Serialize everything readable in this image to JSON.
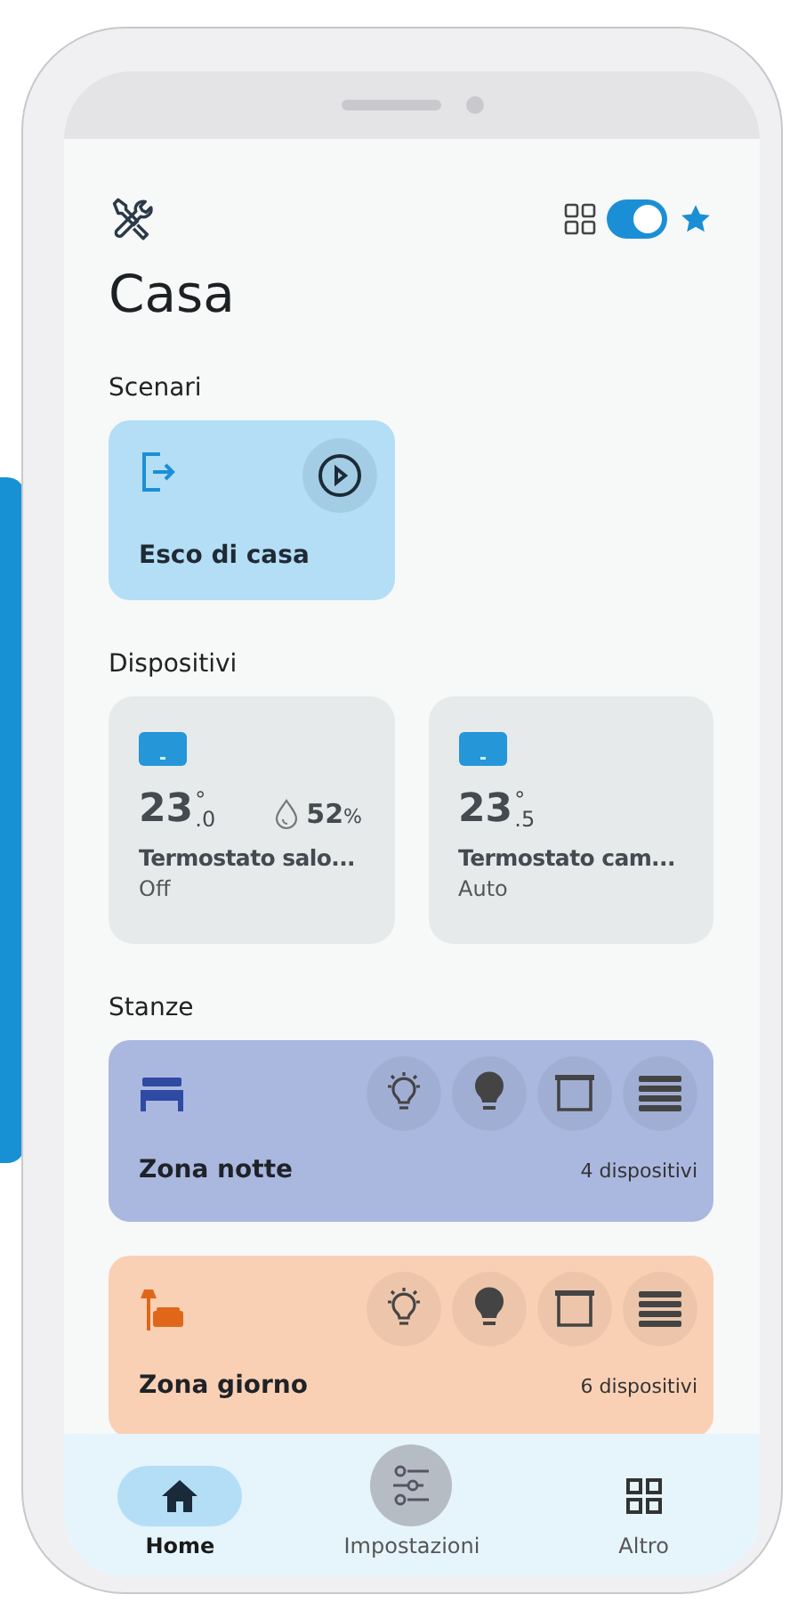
{
  "header": {
    "toggle_on": true
  },
  "title": "Casa",
  "scenarios": {
    "heading": "Scenari",
    "items": [
      {
        "label": "Esco di casa"
      }
    ]
  },
  "devices": {
    "heading": "Dispositivi",
    "items": [
      {
        "temp_int": "23",
        "temp_dec": ".0",
        "temp_unit": "°",
        "humidity": "52",
        "humidity_unit": "%",
        "name": "Termostato salo...",
        "status": "Off"
      },
      {
        "temp_int": "23",
        "temp_dec": ".5",
        "temp_unit": "°",
        "name": "Termostato cam...",
        "status": "Auto"
      }
    ]
  },
  "rooms": {
    "heading": "Stanze",
    "items": [
      {
        "kind": "bed",
        "name": "Zona notte",
        "count": "4 dispositivi",
        "color": "#aab8e0"
      },
      {
        "kind": "sofa",
        "name": "Zona giorno",
        "count": "6 dispositivi",
        "color": "#fad0b5"
      }
    ]
  },
  "nav": [
    {
      "kind": "home",
      "label": "Home",
      "selected": true
    },
    {
      "kind": "settings",
      "label": "Impostazioni",
      "selected": false
    },
    {
      "kind": "grid",
      "label": "Altro",
      "selected": false
    }
  ]
}
